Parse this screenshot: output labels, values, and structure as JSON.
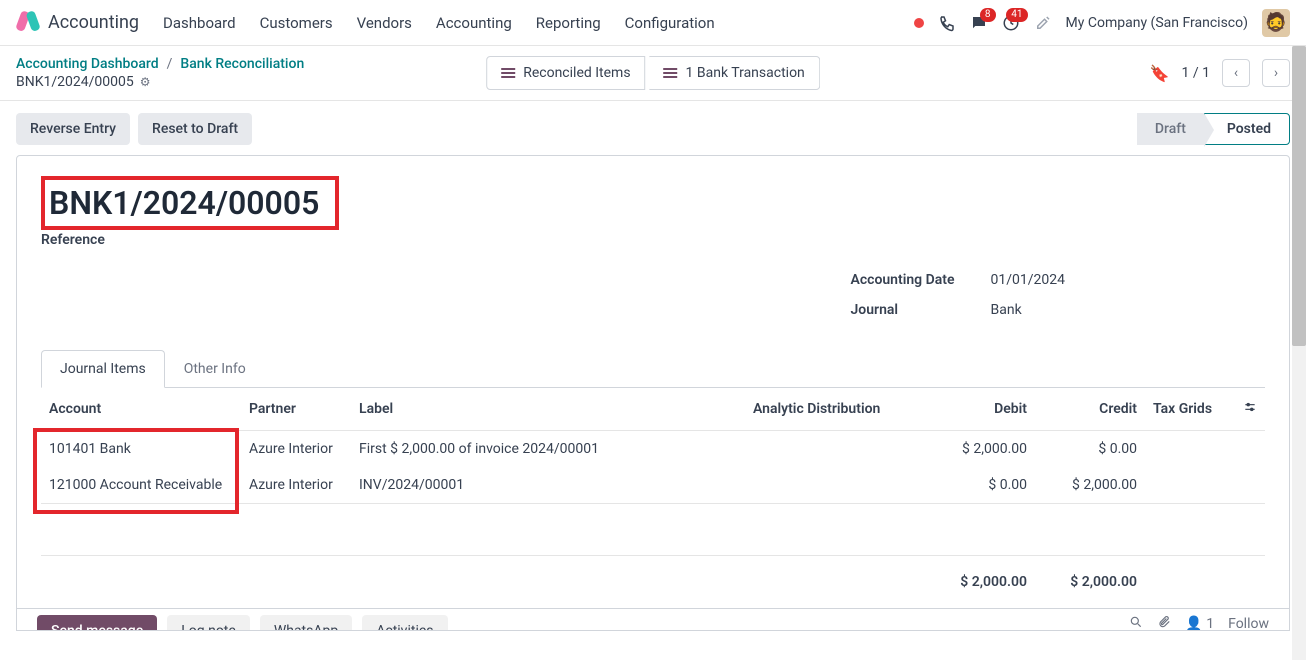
{
  "app_name": "Accounting",
  "nav": [
    "Dashboard",
    "Customers",
    "Vendors",
    "Accounting",
    "Reporting",
    "Configuration"
  ],
  "badges": {
    "messages": "8",
    "activities": "41"
  },
  "company": "My Company (San Francisco)",
  "breadcrumb": {
    "dashboard": "Accounting Dashboard",
    "reconcile": "Bank Reconciliation",
    "record": "BNK1/2024/00005"
  },
  "smart_buttons": {
    "reconciled": "Reconciled Items",
    "bank_tx": "1 Bank Transaction"
  },
  "pager": "1 / 1",
  "actions": {
    "reverse": "Reverse Entry",
    "reset": "Reset to Draft"
  },
  "status": {
    "draft": "Draft",
    "posted": "Posted"
  },
  "entry_name": "BNK1/2024/00005",
  "reference_label": "Reference",
  "fields": {
    "acc_date_label": "Accounting Date",
    "acc_date": "01/01/2024",
    "journal_label": "Journal",
    "journal": "Bank"
  },
  "tabs": {
    "items": "Journal Items",
    "other": "Other Info"
  },
  "columns": {
    "account": "Account",
    "partner": "Partner",
    "label": "Label",
    "analytic": "Analytic Distribution",
    "debit": "Debit",
    "credit": "Credit",
    "tax": "Tax Grids"
  },
  "lines": [
    {
      "account": "101401 Bank",
      "partner": "Azure Interior",
      "label": "First $ 2,000.00 of invoice 2024/00001",
      "debit": "$ 2,000.00",
      "credit": "$ 0.00"
    },
    {
      "account": "121000 Account Receivable",
      "partner": "Azure Interior",
      "label": "INV/2024/00001",
      "debit": "$ 0.00",
      "credit": "$ 2,000.00"
    }
  ],
  "totals": {
    "debit": "$ 2,000.00",
    "credit": "$ 2,000.00"
  },
  "chatter": {
    "send": "Send message",
    "log": "Log note",
    "whatsapp": "WhatsApp",
    "activities": "Activities",
    "followers": "1",
    "follow": "Follow"
  }
}
